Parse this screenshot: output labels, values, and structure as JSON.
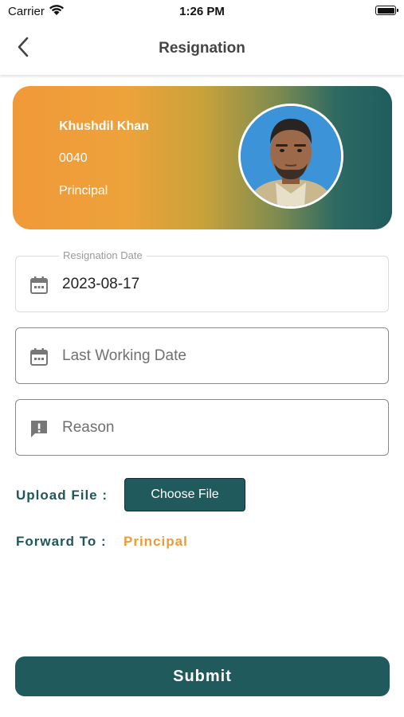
{
  "status_bar": {
    "carrier": "Carrier",
    "time": "1:26 PM"
  },
  "nav": {
    "title": "Resignation",
    "back_icon": "chevron-left-icon"
  },
  "profile": {
    "name": "Khushdil Khan",
    "employee_id": "0040",
    "role": "Principal"
  },
  "form": {
    "resignation_date": {
      "label": "Resignation Date",
      "value": "2023-08-17",
      "icon": "calendar-icon"
    },
    "last_working_date": {
      "placeholder": "Last Working Date",
      "icon": "calendar-icon"
    },
    "reason": {
      "placeholder": "Reason",
      "icon": "feedback-icon"
    },
    "upload_label": "Upload File :",
    "choose_file_label": "Choose File",
    "forward_label": "Forward To :",
    "forward_value": "Principal"
  },
  "submit_label": "Submit",
  "colors": {
    "primary": "#205a5c",
    "accent": "#ef9a35",
    "gradient_start": "#f0993a",
    "gradient_end": "#1e5c5e"
  }
}
